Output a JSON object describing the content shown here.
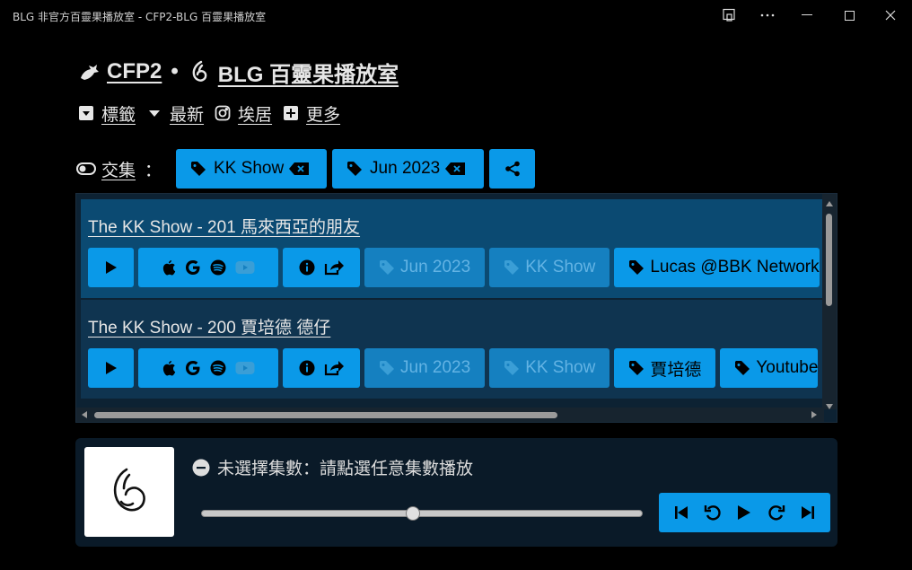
{
  "window": {
    "title": "BLG 非官方百靈果播放室 - CFP2-BLG 百靈果播放室"
  },
  "header": {
    "site_name": "CFP2",
    "separator": "•",
    "page_name": "BLG 百靈果播放室"
  },
  "nav": {
    "items": [
      {
        "label": "標籤",
        "icon": "caret-square-down-icon"
      },
      {
        "label": "最新",
        "icon": "caret-down-icon"
      },
      {
        "label": "埃居",
        "icon": "instagram-icon"
      },
      {
        "label": "更多",
        "icon": "plus-square-icon"
      }
    ]
  },
  "filter": {
    "label": "交集",
    "colon": "：",
    "chips": [
      "KK Show",
      "Jun 2023"
    ]
  },
  "episodes": [
    {
      "title": "The KK Show - 201 馬來西亞的朋友",
      "tags": [
        {
          "label": "Jun 2023",
          "disabled": true
        },
        {
          "label": "KK Show",
          "disabled": true
        },
        {
          "label": "Lucas @BBK Network",
          "disabled": false
        }
      ]
    },
    {
      "title": "The KK Show - 200 賈培德 德仔",
      "tags": [
        {
          "label": "Jun 2023",
          "disabled": true
        },
        {
          "label": "KK Show",
          "disabled": true
        },
        {
          "label": "賈培德",
          "disabled": false
        },
        {
          "label": "Youtube",
          "disabled": false
        }
      ]
    }
  ],
  "player": {
    "status": "未選擇集數：請點選任意集數播放",
    "progress_percent": 48
  },
  "colors": {
    "accent": "#0a99e8",
    "accent_disabled": "#1580c0",
    "selected_row": "#0b4a72",
    "row": "#0f3450",
    "panel": "#0a1a28",
    "background": "#000000"
  }
}
